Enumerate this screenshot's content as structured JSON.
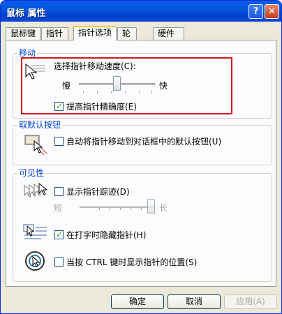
{
  "window": {
    "title": "鼠标 属性",
    "help_label": "?",
    "close_label": "✕"
  },
  "tabs": [
    {
      "label": "鼠标键"
    },
    {
      "label": "指针"
    },
    {
      "label": "指针选项"
    },
    {
      "label": "轮"
    },
    {
      "label": "硬件"
    }
  ],
  "motion": {
    "title": "移动",
    "speed_label": "选择指针移动速度(C):",
    "slow": "慢",
    "fast": "快",
    "speed_level": 0.5,
    "precision_label": "提高指针精确度(E)",
    "precision_checked": true
  },
  "snapto": {
    "title": "取默认按钮",
    "label": "自动将指针移动到对话框中的默认按钮(U)",
    "checked": false
  },
  "visibility": {
    "title": "可见性",
    "trails_label": "显示指针踪迹(D)",
    "trails_checked": false,
    "short": "短",
    "long": "长",
    "trails_level": 1.0,
    "hide_label": "在打字时隐藏指针(H)",
    "hide_checked": true,
    "ctrl_label": "当按 CTRL 键时显示指针的位置(S)",
    "ctrl_checked": false
  },
  "buttons": {
    "ok": "确定",
    "cancel": "取消",
    "apply": "应用(A)"
  },
  "colors": {
    "highlight": "#d4141e",
    "title_blue": "#0046d5",
    "check": "#21a121"
  }
}
